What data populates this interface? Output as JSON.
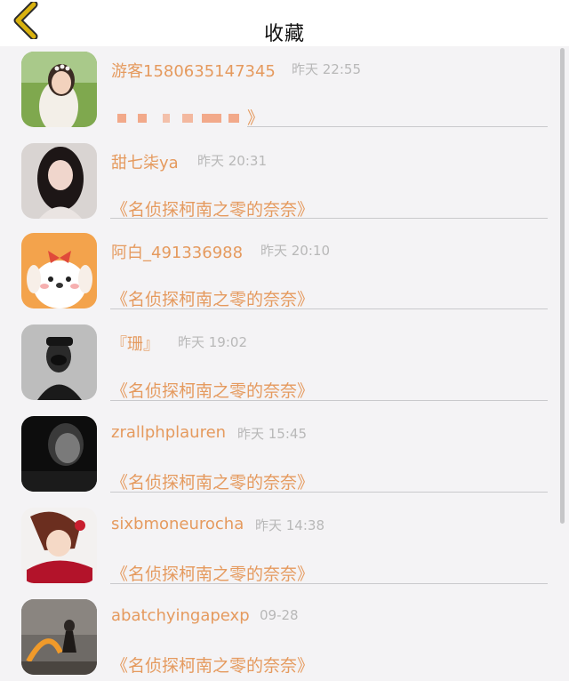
{
  "header": {
    "title": "收藏",
    "back_icon": "chevron-left-icon",
    "accent_color": "#d9b20f"
  },
  "favorites": [
    {
      "name": "游客1580635147345",
      "time": "昨天 22:55",
      "comment": "》"
    },
    {
      "name": "甜七柒ya",
      "time": "昨天 20:31",
      "comment": "《名侦探柯南之零的奈奈》"
    },
    {
      "name": "阿白_491336988",
      "time": "昨天 20:10",
      "comment": "《名侦探柯南之零的奈奈》"
    },
    {
      "name": "『珊』",
      "time": "昨天 19:02",
      "comment": "《名侦探柯南之零的奈奈》"
    },
    {
      "name": "zrallphplauren",
      "time": "昨天 15:45",
      "comment": "《名侦探柯南之零的奈奈》"
    },
    {
      "name": "sixbmoneurocha",
      "time": "昨天 14:38",
      "comment": "《名侦探柯南之零的奈奈》"
    },
    {
      "name": "abatchyingapexp",
      "time": "09-28",
      "comment": "《名侦探柯南之零的奈奈》"
    }
  ],
  "colors": {
    "name_text": "#e59a5e",
    "time_text": "#b8b8b8",
    "background": "#f4f3f5"
  }
}
